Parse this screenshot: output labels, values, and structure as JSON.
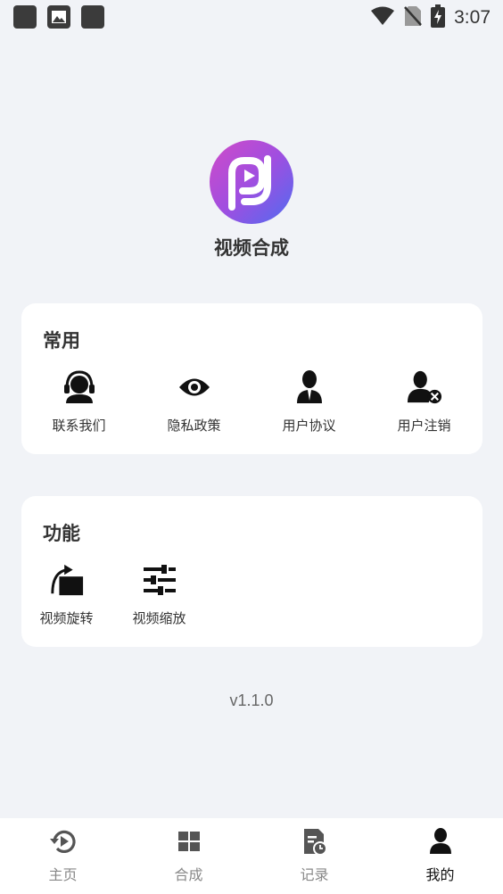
{
  "status_bar": {
    "time": "3:07",
    "icons": [
      "notification-square-icon",
      "image-icon",
      "notification-square-icon",
      "wifi-icon",
      "no-sim-icon",
      "battery-charging-icon"
    ]
  },
  "app": {
    "name": "视频合成",
    "logo_icon": "app-logo-icon"
  },
  "sections": {
    "common": {
      "title": "常用",
      "items": [
        {
          "label": "联系我们",
          "icon": "headset-support-icon"
        },
        {
          "label": "隐私政策",
          "icon": "eye-icon"
        },
        {
          "label": "用户协议",
          "icon": "user-agreement-icon"
        },
        {
          "label": "用户注销",
          "icon": "user-remove-icon"
        }
      ]
    },
    "functions": {
      "title": "功能",
      "items": [
        {
          "label": "视频旋转",
          "icon": "rotate-icon"
        },
        {
          "label": "视频缩放",
          "icon": "sliders-icon"
        }
      ]
    }
  },
  "version": "v1.1.0",
  "bottom_nav": {
    "items": [
      {
        "label": "主页",
        "icon": "home-replay-icon",
        "active": false
      },
      {
        "label": "合成",
        "icon": "grid-icon",
        "active": false
      },
      {
        "label": "记录",
        "icon": "record-document-icon",
        "active": false
      },
      {
        "label": "我的",
        "icon": "profile-icon",
        "active": true
      }
    ]
  },
  "colors": {
    "background": "#f1f3f7",
    "card": "#ffffff",
    "logo_gradient_start": "#c04ad8",
    "logo_gradient_end": "#4f6cf0",
    "nav_active": "#111111",
    "nav_inactive": "#888888"
  }
}
